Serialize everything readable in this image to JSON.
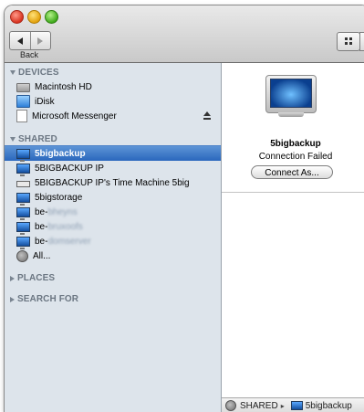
{
  "toolbar": {
    "back_label": "Back"
  },
  "sidebar": {
    "devices": {
      "header": "DEVICES",
      "items": [
        {
          "label": "Macintosh HD",
          "icon": "hard-drive-icon"
        },
        {
          "label": "iDisk",
          "icon": "idisk-icon"
        },
        {
          "label": "Microsoft Messenger",
          "icon": "disk-image-icon",
          "ejectable": true
        }
      ]
    },
    "shared": {
      "header": "SHARED",
      "items": [
        {
          "label": "5bigbackup",
          "icon": "monitor-icon",
          "selected": true
        },
        {
          "label": "5BIGBACKUP IP",
          "icon": "monitor-icon"
        },
        {
          "label": "5BIGBACKUP IP's Time Machine 5big",
          "icon": "time-machine-icon"
        },
        {
          "label": "5bigstorage",
          "icon": "monitor-icon"
        },
        {
          "prefix": "be-",
          "label": "bheyns",
          "icon": "monitor-icon",
          "obscured": true
        },
        {
          "prefix": "be-",
          "label": "bruxoofs",
          "icon": "monitor-icon",
          "obscured": true
        },
        {
          "prefix": "be-",
          "label": "domserver",
          "icon": "monitor-icon",
          "obscured": true
        },
        {
          "label": "All...",
          "icon": "network-globe-icon"
        }
      ]
    },
    "places": {
      "header": "PLACES"
    },
    "search_for": {
      "header": "SEARCH FOR"
    }
  },
  "main": {
    "server_name": "5bigbackup",
    "status": "Connection Failed",
    "connect_button": "Connect As..."
  },
  "pathbar": {
    "segments": [
      "SHARED",
      "5bigbackup"
    ],
    "separator": "▸"
  }
}
